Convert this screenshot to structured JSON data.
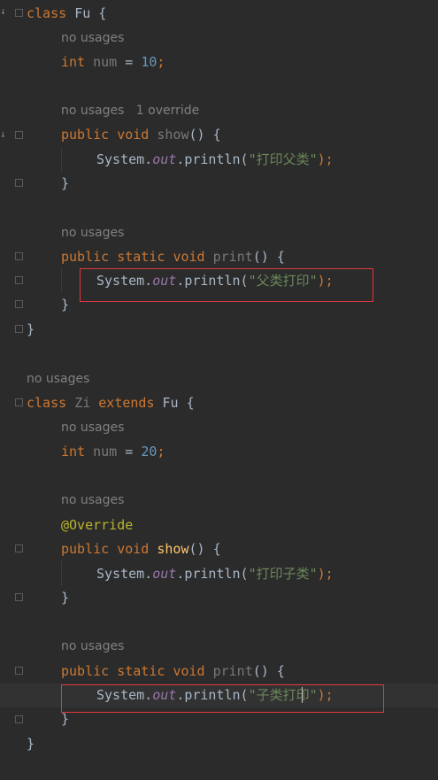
{
  "hints": {
    "no_usages": "no usages",
    "one_override": "1 override"
  },
  "code": {
    "fu_class_line": [
      "class",
      "Fu",
      "{"
    ],
    "fu_field": [
      "int",
      "num",
      "=",
      "10",
      ";"
    ],
    "fu_show_sig": [
      "public",
      "void",
      "show",
      "()",
      "{"
    ],
    "fu_show_body": [
      "System.",
      "out",
      ".println(",
      "\"打印父类\"",
      ");"
    ],
    "close_brace": "}",
    "fu_print_sig": [
      "public",
      "static",
      "void",
      "print",
      "()",
      "{"
    ],
    "fu_print_body": [
      "System.",
      "out",
      ".println(",
      "\"父类打印\"",
      ");"
    ],
    "zi_class_line": [
      "class",
      "Zi",
      "extends",
      "Fu",
      "{"
    ],
    "zi_field": [
      "int",
      "num",
      "=",
      "20",
      ";"
    ],
    "annotation": "@Override",
    "zi_show_sig": [
      "public",
      "void",
      "show",
      "()",
      "{"
    ],
    "zi_show_body": [
      "System.",
      "out",
      ".println(",
      "\"打印子类\"",
      ");"
    ],
    "zi_print_sig": [
      "public",
      "static",
      "void",
      "print",
      "()",
      "{"
    ],
    "zi_print_body": [
      "System.",
      "out",
      ".println(",
      "\"子类打印\"",
      ");"
    ]
  },
  "colors": {
    "background": "#2b2b2b",
    "keyword": "#cc7832",
    "string": "#6a8759",
    "number": "#6897bb",
    "field": "#9876aa",
    "method": "#ffc66d",
    "annotation": "#bbb529",
    "hint": "#808080",
    "highlight_box": "#e0383e"
  }
}
